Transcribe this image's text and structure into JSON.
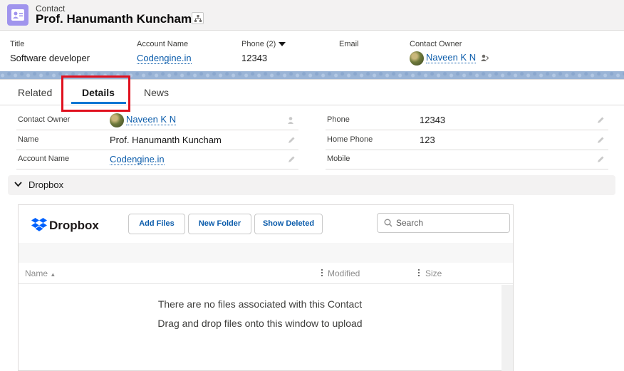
{
  "header": {
    "object_type": "Contact",
    "record_name": "Prof. Hanumanth Kuncham"
  },
  "highlights": {
    "title_label": "Title",
    "title_value": "Software developer",
    "account_label": "Account Name",
    "account_value": "Codengine.in",
    "phone_label": "Phone (2)",
    "phone_value": "12343",
    "email_label": "Email",
    "email_value": "",
    "owner_label": "Contact Owner",
    "owner_value": "Naveen K N"
  },
  "tabs": {
    "related": "Related",
    "details": "Details",
    "news": "News"
  },
  "details": {
    "contact_owner_label": "Contact Owner",
    "contact_owner_value": "Naveen K N",
    "name_label": "Name",
    "name_value": "Prof. Hanumanth Kuncham",
    "account_label": "Account Name",
    "account_value": "Codengine.in",
    "phone_label": "Phone",
    "phone_value": "12343",
    "home_phone_label": "Home Phone",
    "home_phone_value": "123",
    "mobile_label": "Mobile",
    "mobile_value": ""
  },
  "dropbox_section": {
    "title": "Dropbox"
  },
  "dropbox": {
    "brand": "Dropbox",
    "add_files": "Add Files",
    "new_folder": "New Folder",
    "show_deleted": "Show Deleted",
    "search_placeholder": "Search",
    "col_name": "Name",
    "col_modified": "Modified",
    "col_size": "Size",
    "empty_line1": "There are no files associated with this Contact",
    "empty_line2": "Drag and drop files onto this window to upload"
  },
  "colors": {
    "accent": "#0176d3",
    "link": "#0b5cab",
    "contact_icon": "#a094ed",
    "highlight_box": "#e0101e",
    "dropbox_blue": "#0061fe"
  }
}
